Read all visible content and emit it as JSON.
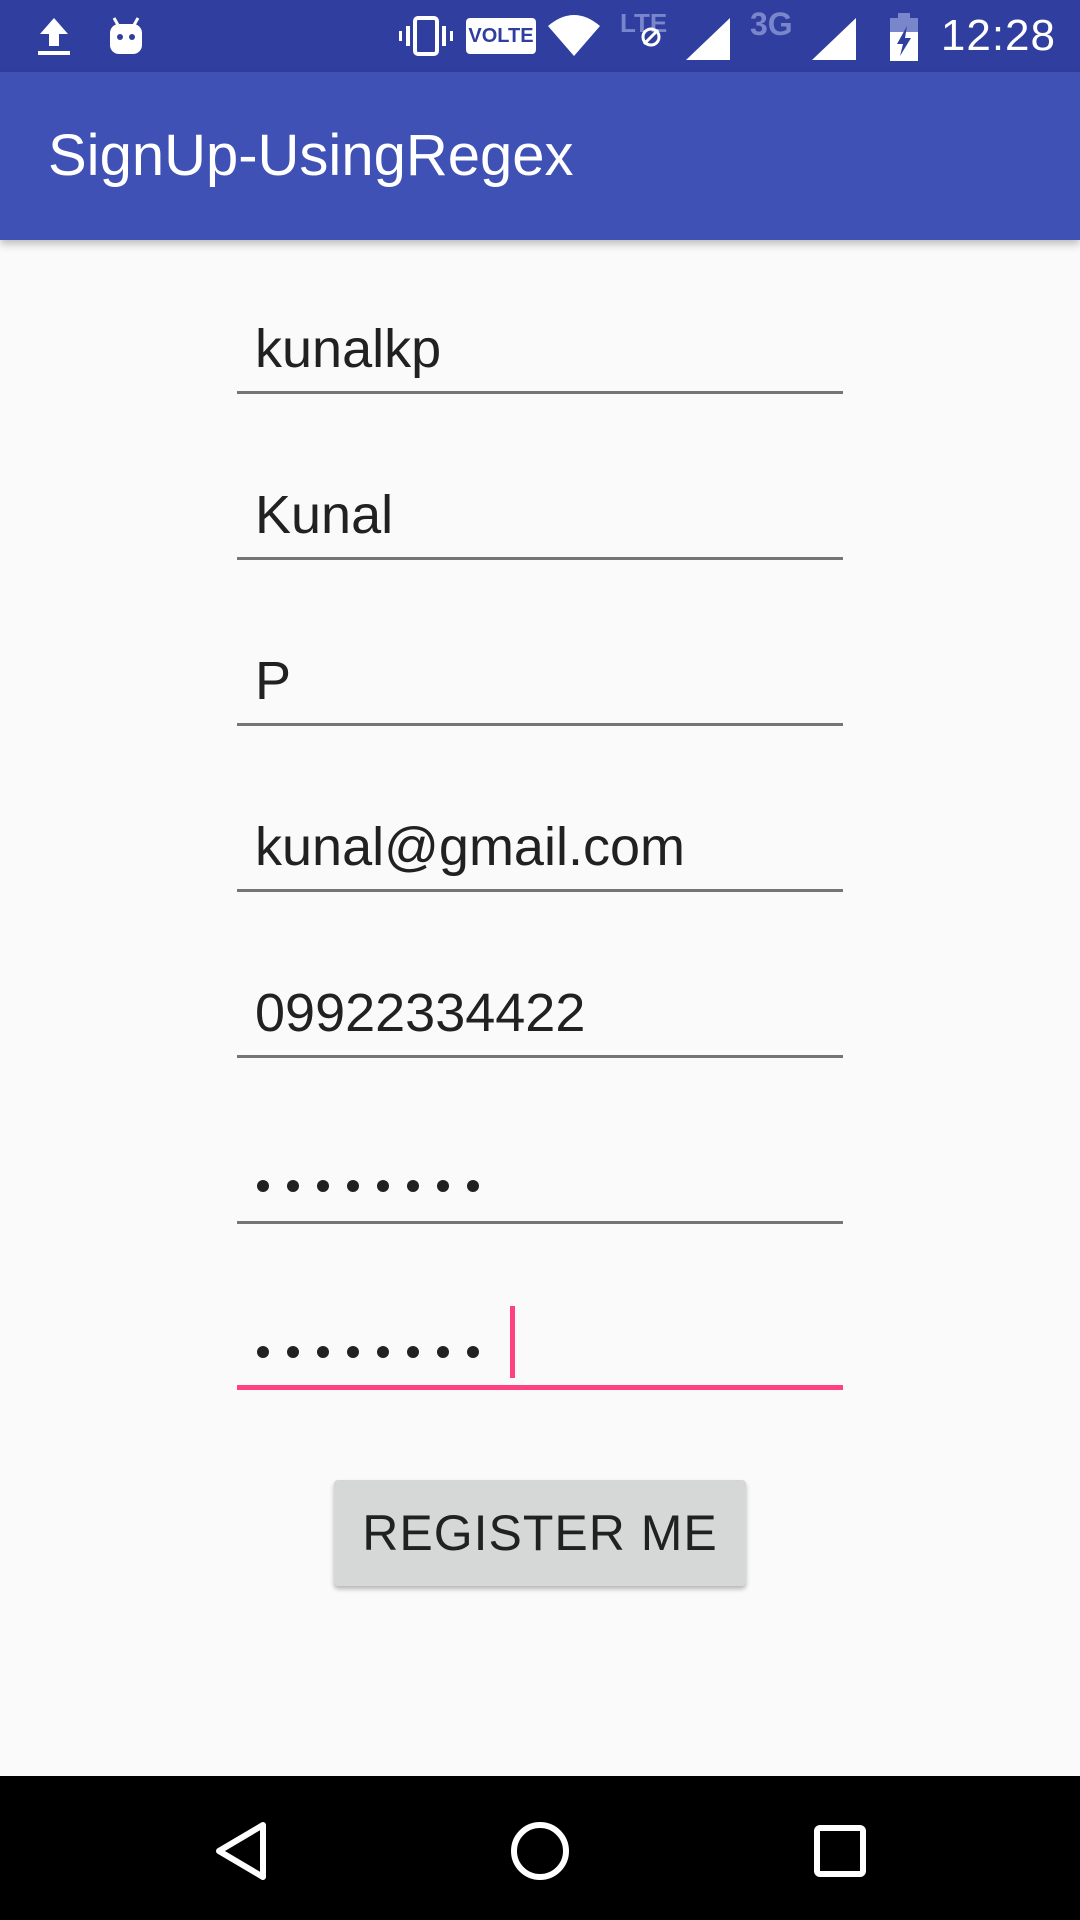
{
  "status_bar": {
    "time": "12:28",
    "icons": [
      "upload-icon",
      "android-icon",
      "vibrate-icon",
      "volte-icon",
      "wifi-icon",
      "lte-icon",
      "signal-icon",
      "3g-icon",
      "signal-icon",
      "battery-charging-icon"
    ],
    "volte_label": "VOLTE",
    "lte_label": "LTE",
    "network_3g_label": "3G"
  },
  "app_bar": {
    "title": "SignUp-UsingRegex"
  },
  "form": {
    "username": "kunalkp",
    "first_name": "Kunal",
    "last_name": "P",
    "email": "kunal@gmail.com",
    "phone": "09922334422",
    "password_mask_count": 8,
    "confirm_password_mask_count": 8,
    "register_label": "REGISTER ME"
  },
  "colors": {
    "status_bar": "#303f9f",
    "app_bar": "#3f51b5",
    "accent": "#ff4081",
    "button": "#d6d7d7",
    "background": "#fafafa"
  },
  "nav_bar": {
    "icons": [
      "back-icon",
      "home-icon",
      "recents-icon"
    ]
  }
}
